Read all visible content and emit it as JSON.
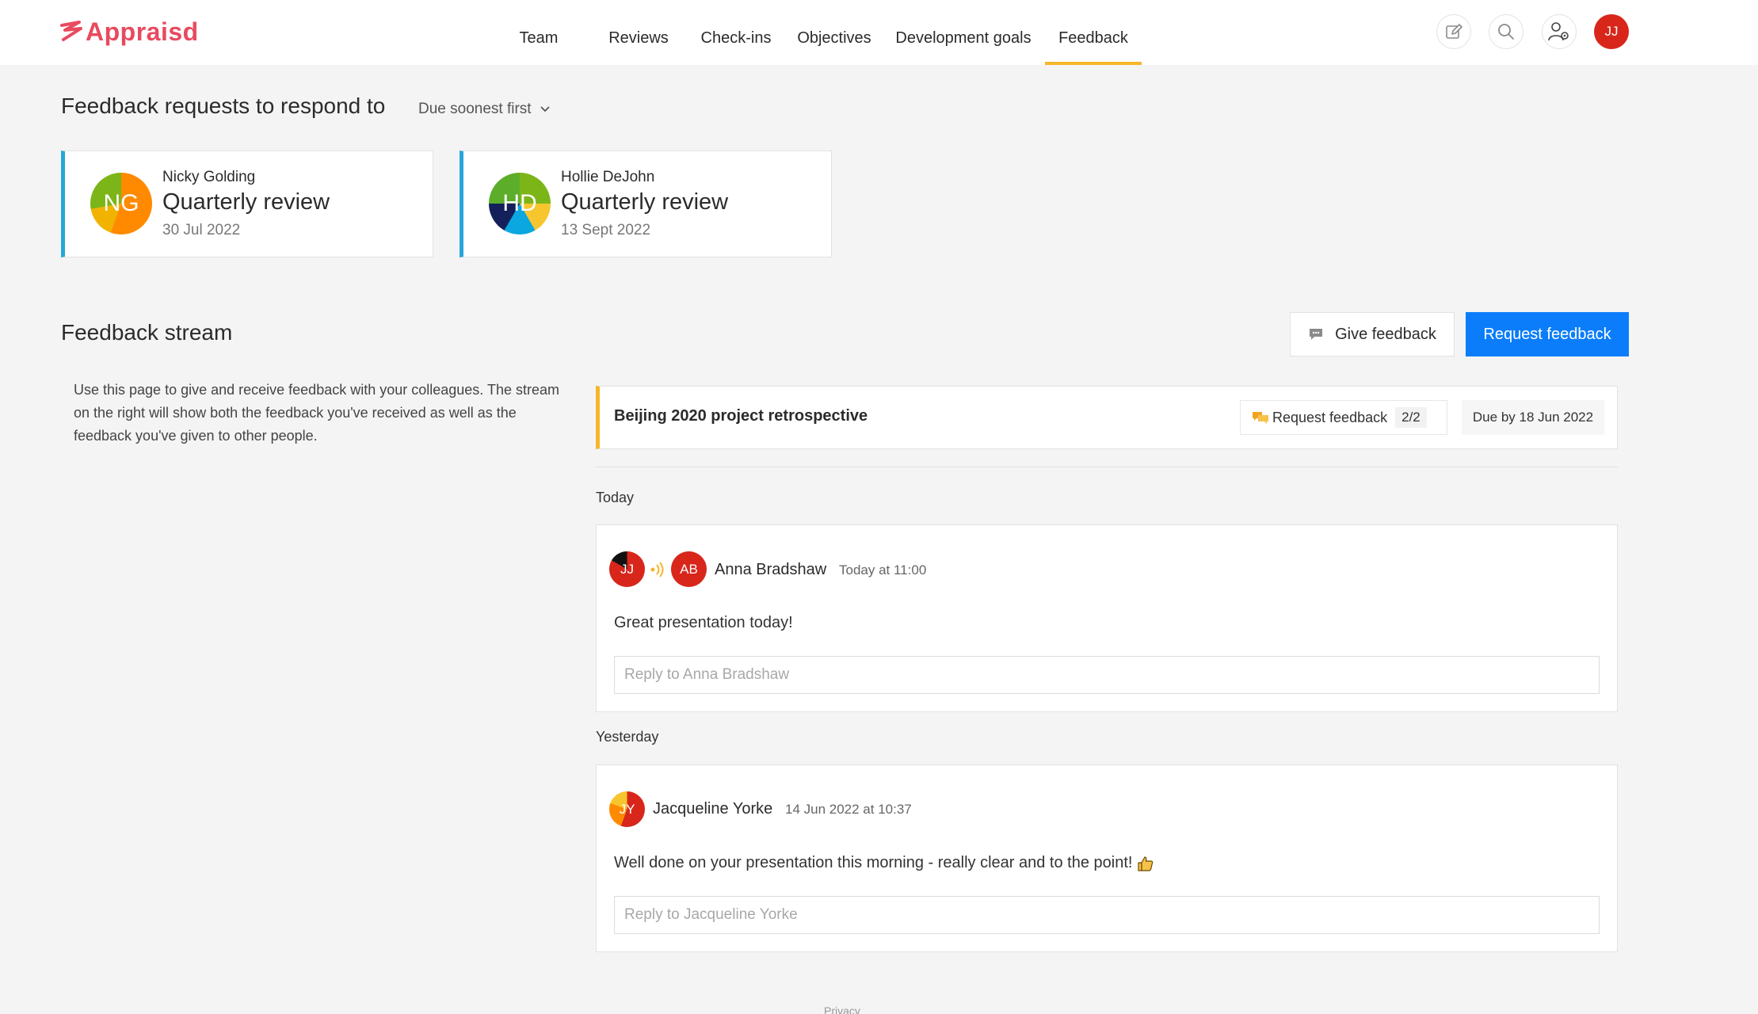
{
  "app": {
    "name": "Appraisd",
    "brand_color": "#e84a5f"
  },
  "nav": {
    "items": [
      {
        "label": "Team"
      },
      {
        "label": "Reviews"
      },
      {
        "label": "Check-ins"
      },
      {
        "label": "Objectives"
      },
      {
        "label": "Development goals"
      },
      {
        "label": "Feedback",
        "active": true
      }
    ],
    "accent_color": "#f7b529"
  },
  "header_icons": [
    "edit-icon",
    "search-icon",
    "user-settings-icon"
  ],
  "current_user": {
    "initials": "JJ"
  },
  "requests": {
    "title": "Feedback requests to respond to",
    "sort_label": "Due soonest first",
    "cards": [
      {
        "initials": "NG",
        "name": "Nicky Golding",
        "title": "Quarterly review",
        "date": "30 Jul 2022"
      },
      {
        "initials": "HD",
        "name": "Hollie DeJohn",
        "title": "Quarterly review",
        "date": "13 Sept 2022"
      }
    ]
  },
  "stream": {
    "title": "Feedback stream",
    "give_label": "Give feedback",
    "request_label": "Request feedback",
    "intro": "Use this page to give and receive feedback with your colleagues. The stream on the right will show both the feedback you've received as well as the feedback you've given to other people.",
    "project": {
      "title": "Beijing 2020 project retrospective",
      "request_label": "Request feedback",
      "count": "2/2",
      "due": "Due by 18 Jun 2022"
    },
    "groups": [
      {
        "label": "Today",
        "item": {
          "from_initials": "JJ",
          "to_initials": "AB",
          "author": "Anna Bradshaw",
          "time": "Today at 11:00",
          "message": "Great presentation today!",
          "reply_placeholder": "Reply to Anna Bradshaw"
        }
      },
      {
        "label": "Yesterday",
        "item": {
          "from_initials": "JY",
          "author": "Jacqueline Yorke",
          "time": "14 Jun 2022 at 10:37",
          "message": "Well done on your presentation this morning - really clear and to the point!",
          "reply_placeholder": "Reply to Jacqueline Yorke"
        }
      }
    ]
  },
  "footer": {
    "privacy": "Privacy"
  }
}
